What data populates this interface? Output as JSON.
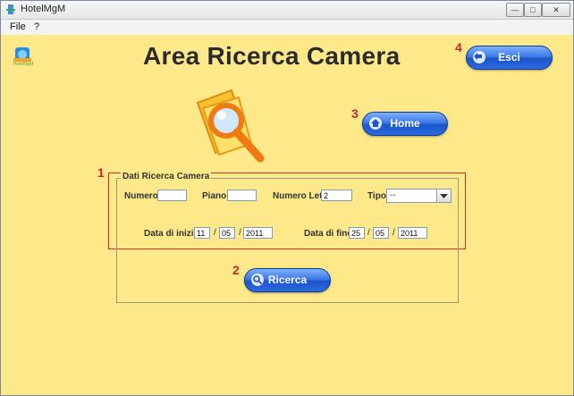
{
  "window": {
    "title": "HotelMgM",
    "minimize": "—",
    "maximize": "□",
    "close": "✕"
  },
  "menu": {
    "items": [
      {
        "label": "File"
      },
      {
        "label": "?"
      }
    ]
  },
  "logo": {
    "text": "HotelMgM"
  },
  "page": {
    "title": "Area Ricerca Camera"
  },
  "buttons": {
    "exit": "Esci",
    "home": "Home",
    "search": "Ricerca"
  },
  "annotations": {
    "search_panel": "1",
    "search_button": "2",
    "home_button": "3",
    "exit_button": "4"
  },
  "search_form": {
    "legend": "Dati Ricerca Camera",
    "numero": {
      "label": "Numero",
      "value": ""
    },
    "piano": {
      "label": "Piano",
      "value": ""
    },
    "numero_letti": {
      "label": "Numero Letti",
      "value": "2"
    },
    "tipo": {
      "label": "Tipo",
      "value": "--"
    },
    "data_inizio": {
      "label": "Data di inizio",
      "day": "11",
      "month": "05",
      "year": "2011"
    },
    "data_fine": {
      "label": "Data di fine",
      "day": "25",
      "month": "05",
      "year": "2011"
    },
    "date_separator": "/"
  },
  "colors": {
    "background": "#fde98a",
    "button_blue": "#2d6ae0",
    "annotation_red": "#c62828"
  },
  "icons": {
    "app": "hotel-app-icon",
    "search": "magnifier-folder-icon",
    "home": "house-icon",
    "exit": "exit-arrow-icon",
    "search_button": "magnifier-icon",
    "dropdown": "chevron-down-icon"
  }
}
